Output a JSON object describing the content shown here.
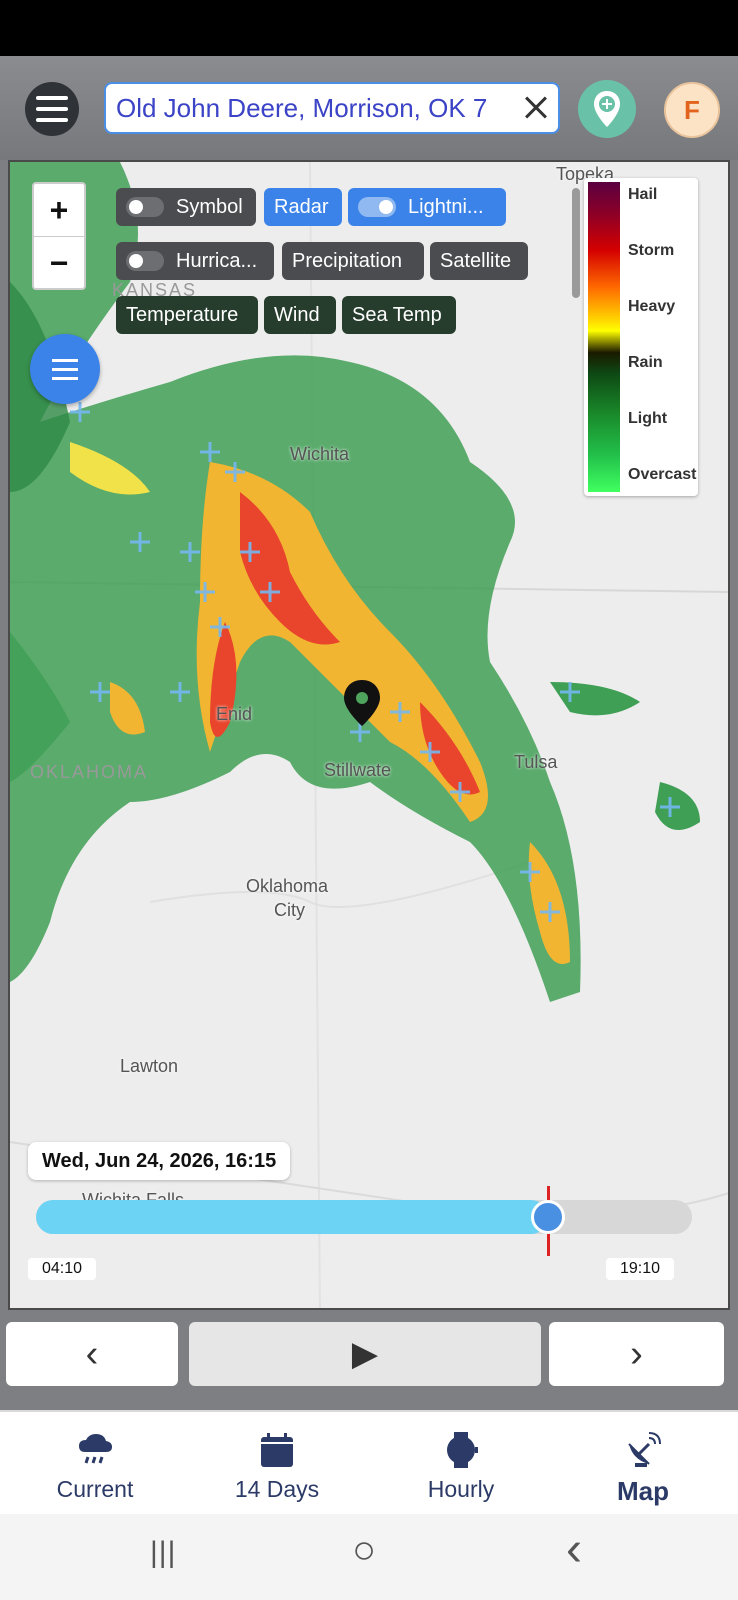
{
  "search": {
    "value": "Old John Deere, Morrison, OK 7"
  },
  "unit_label": "F",
  "layer_chips": [
    {
      "label": "Symbol"
    },
    {
      "label": "Radar"
    },
    {
      "label": "Lightni..."
    },
    {
      "label": "Hurrica..."
    },
    {
      "label": "Precipitation"
    },
    {
      "label": "Satellite"
    },
    {
      "label": "Temperature"
    },
    {
      "label": "Wind"
    },
    {
      "label": "Sea Temp"
    }
  ],
  "legend": {
    "labels": [
      "Hail",
      "Storm",
      "Heavy",
      "Rain",
      "Light",
      "Overcast"
    ]
  },
  "map_labels": {
    "cities": [
      "Topeka",
      "Wichita",
      "Enid",
      "Stillwate",
      "Tulsa",
      "Oklahoma",
      "City",
      "Lawton",
      "Wichita Falls"
    ],
    "states": [
      "KANSAS",
      "OKLAHOMA"
    ]
  },
  "timeline": {
    "current": "Wed, Jun 24, 2026, 16:15",
    "start": "04:10",
    "end": "19:10",
    "progress": 0.78
  },
  "controls": {
    "prev": "‹",
    "play": "▶",
    "next": "›"
  },
  "tabs": [
    {
      "label": "Current",
      "icon": "cloud-rain-icon"
    },
    {
      "label": "14 Days",
      "icon": "calendar-icon"
    },
    {
      "label": "Hourly",
      "icon": "watch-icon"
    },
    {
      "label": "Map",
      "icon": "satellite-dish-icon"
    }
  ],
  "nav": {
    "recent": "|||",
    "home": "○",
    "back": "‹"
  }
}
